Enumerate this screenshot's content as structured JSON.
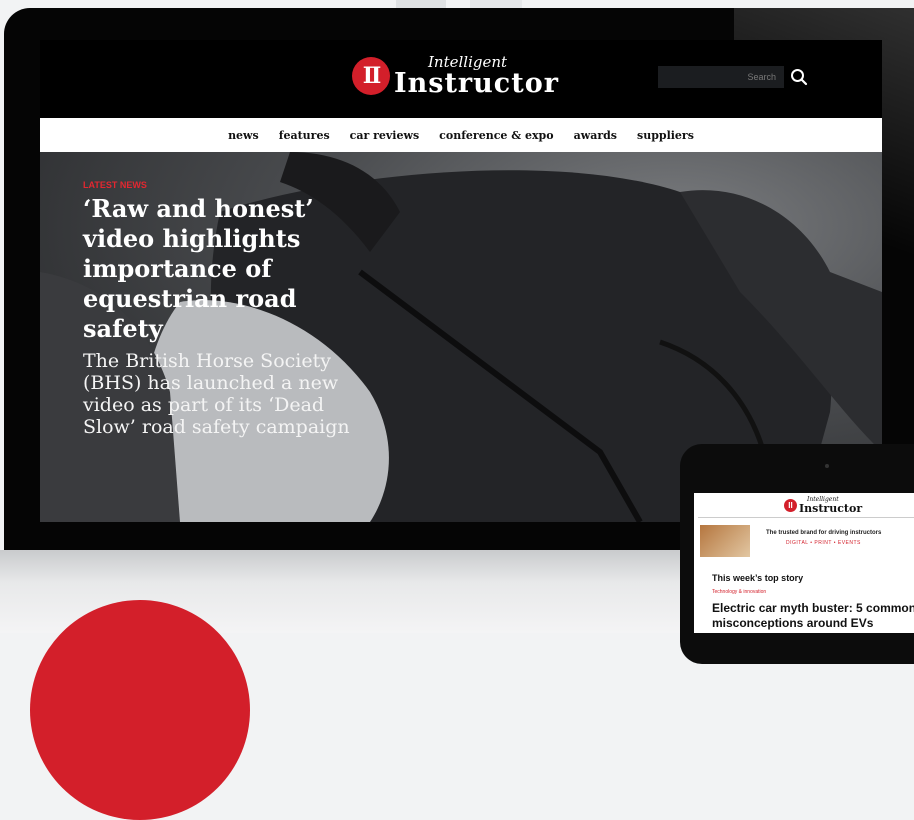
{
  "site": {
    "logo_small": "Intelligent",
    "logo_big": "Instructor",
    "logo_badge": "II",
    "search_placeholder": "Search"
  },
  "nav": [
    {
      "label": "news"
    },
    {
      "label": "features"
    },
    {
      "label": "car reviews"
    },
    {
      "label": "conference & expo"
    },
    {
      "label": "awards"
    },
    {
      "label": "suppliers"
    }
  ],
  "hero": {
    "tag": "LATEST NEWS",
    "headline": "‘Raw and honest’ video highlights importance of equestrian road safety",
    "standfirst": "The British Horse Society (BHS) has launched a new video as part of its ‘Dead Slow’ road safety campaign"
  },
  "tablet": {
    "logo_small": "Intelligent",
    "logo_big": "Instructor",
    "logo_badge": "II",
    "tagline": "The trusted brand for driving instructors",
    "sub": "DIGITAL • PRINT • EVENTS",
    "section_title": "This week’s top story",
    "topic": "Technology & innovation",
    "headline": "Electric car myth buster: 5 common misconceptions around EVs"
  },
  "colors": {
    "brand_red": "#d31f2a",
    "header_bg": "#000000",
    "nav_bg": "#ffffff"
  },
  "icons": [
    "search-icon",
    "logo-badge"
  ]
}
